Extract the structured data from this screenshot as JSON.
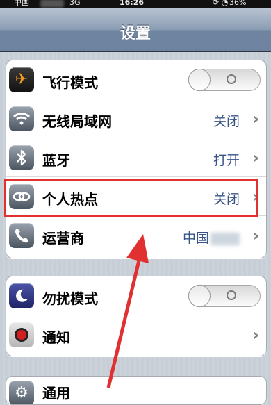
{
  "status_bar": {
    "carrier": "中国",
    "network": "3G",
    "time": "16:26",
    "battery": "36%"
  },
  "nav": {
    "title": "设置"
  },
  "groups": [
    {
      "rows": [
        {
          "label": "飞行模式",
          "icon": "airplane-icon",
          "control": "toggle",
          "toggle_on": false
        },
        {
          "label": "无线局域网",
          "icon": "wifi-icon",
          "value": "关闭"
        },
        {
          "label": "蓝牙",
          "icon": "bluetooth-icon",
          "value": "打开"
        },
        {
          "label": "个人热点",
          "icon": "hotspot-icon",
          "value": "关闭",
          "highlighted": true
        },
        {
          "label": "运营商",
          "icon": "phone-icon",
          "value": "中国"
        }
      ]
    },
    {
      "rows": [
        {
          "label": "勿扰模式",
          "icon": "moon-icon",
          "control": "toggle",
          "toggle_on": false
        },
        {
          "label": "通知",
          "icon": "notification-icon"
        }
      ]
    },
    {
      "rows": [
        {
          "label": "通用",
          "icon": "gear-icon"
        }
      ]
    }
  ],
  "colors": {
    "value_text": "#385487",
    "highlight_box": "#e0302f",
    "arrow": "#e0302f",
    "airplane_icon": "#f49a1c"
  }
}
